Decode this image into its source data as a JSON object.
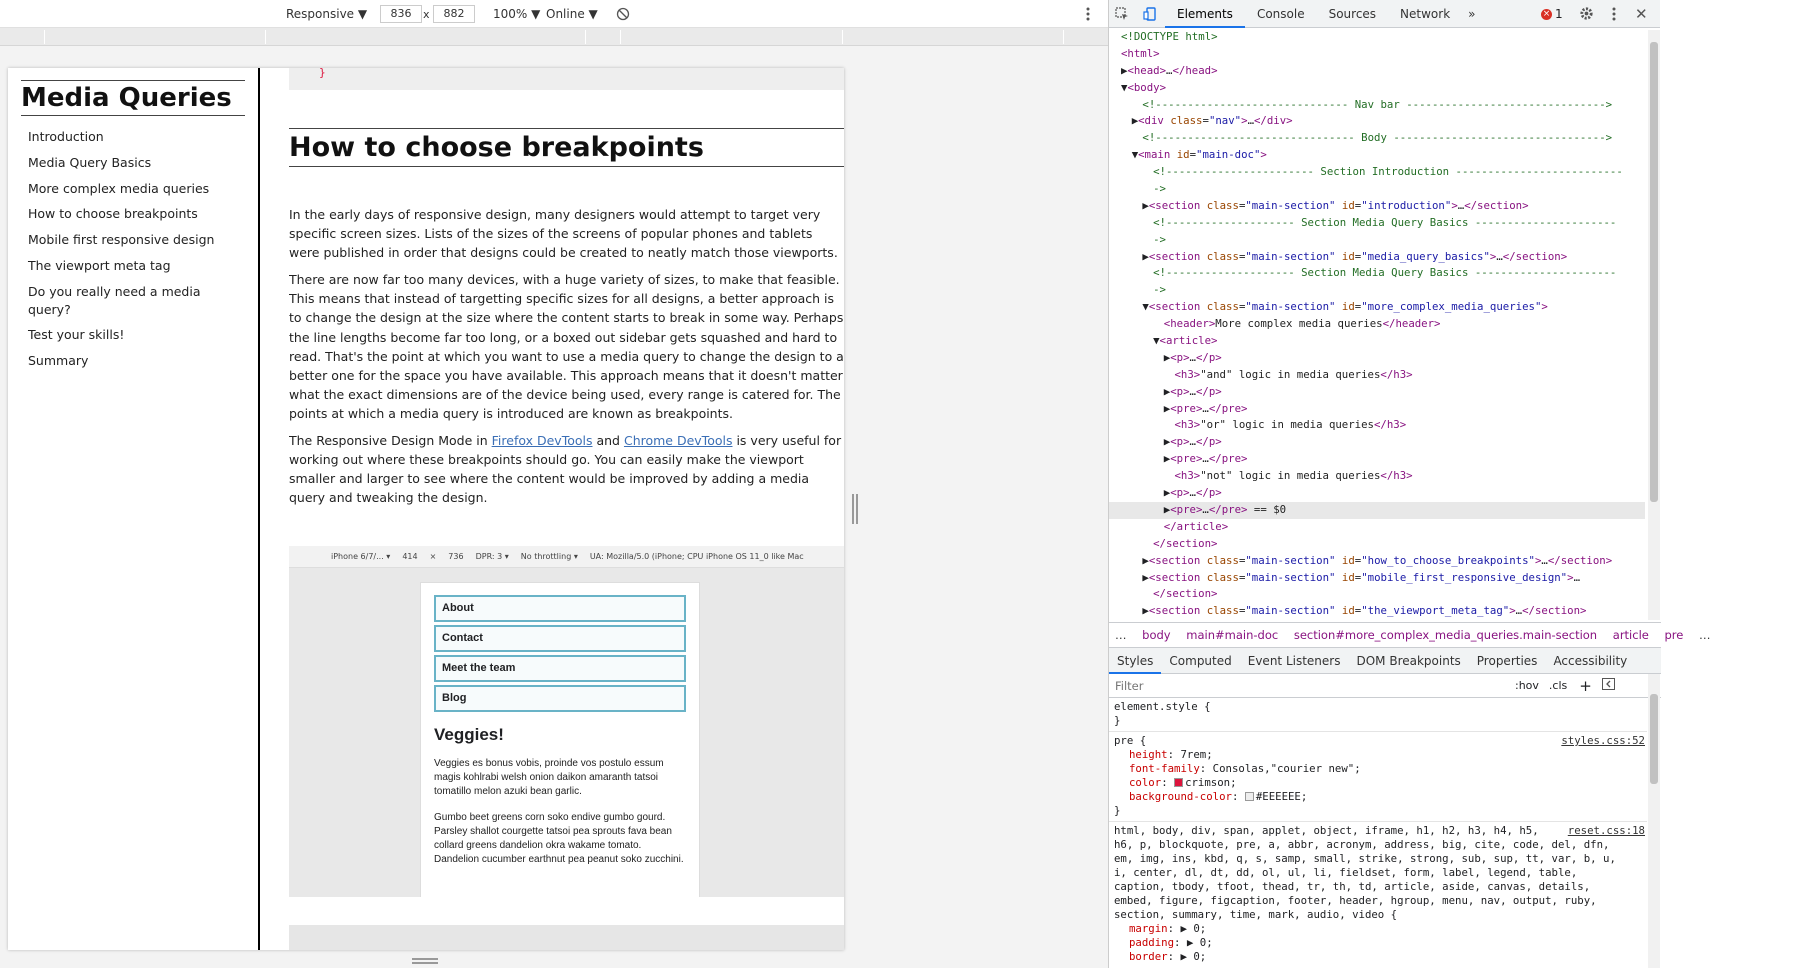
{
  "toolbar": {
    "device": "Responsive ▼",
    "width": "836",
    "times": "x",
    "height": "882",
    "zoom": "100% ▼",
    "network": "Online ▼"
  },
  "sidebar": {
    "title": "Media Queries",
    "items": [
      "Introduction",
      "Media Query Basics",
      "More complex media queries",
      "How to choose breakpoints",
      "Mobile first responsive design",
      "The viewport meta tag",
      "Do you really need a media query?",
      "Test your skills!",
      "Summary"
    ]
  },
  "main": {
    "pre_tail": "}",
    "heading": "How to choose breakpoints",
    "p1": "In the early days of responsive design, many designers would attempt to target very specific screen sizes. Lists of the sizes of the screens of popular phones and tablets were published in order that designs could be created to neatly match those viewports.",
    "p2": "There are now far too many devices, with a huge variety of sizes, to make that feasible. This means that instead of targetting specific sizes for all designs, a better approach is to change the design at the size where the content starts to break in some way. Perhaps the line lengths become far too long, or a boxed out sidebar gets squashed and hard to read. That's the point at which you want to use a media query to change the design to a better one for the space you have available. This approach means that it doesn't matter what the exact dimensions are of the device being used, every range is catered for. The points at which a media query is introduced are known as breakpoints.",
    "p3_a": "The Responsive Design Mode in ",
    "p3_link1": "Firefox DevTools",
    "p3_b": " and ",
    "p3_link2": "Chrome DevTools",
    "p3_c": " is very useful for working out where these breakpoints should go. You can easily make the viewport smaller and larger to see where the content would be improved by adding a media query and tweaking the design."
  },
  "screenshot": {
    "bar": [
      "iPhone 6/7/... ▾",
      "414",
      "×",
      "736",
      "DPR: 3 ▾",
      "No throttling ▾",
      "UA: Mozilla/5.0 (iPhone; CPU iPhone OS 11_0 like Mac"
    ],
    "nav": [
      "About",
      "Contact",
      "Meet the team",
      "Blog"
    ],
    "heading": "Veggies!",
    "p1": "Veggies es bonus vobis, proinde vos postulo essum magis kohlrabi welsh onion daikon amaranth tatsoi tomatillo melon azuki bean garlic.",
    "p2": "Gumbo beet greens corn soko endive gumbo gourd. Parsley shallot courgette tatsoi pea sprouts fava bean collard greens dandelion okra wakame tomato. Dandelion cucumber earthnut pea peanut soko zucchini."
  },
  "devtools": {
    "tabs": [
      "Elements",
      "Console",
      "Sources",
      "Network"
    ],
    "error_count": "1",
    "dom": [
      {
        "html": "<span class='cmt'>&lt;!DOCTYPE html&gt;</span>",
        "indent": 0
      },
      {
        "html": "<span class='tagc'>&lt;html&gt;</span>",
        "indent": 0
      },
      {
        "html": "▶<span class='tagc'>&lt;head&gt;</span>…<span class='tagc'>&lt;/head&gt;</span>",
        "indent": 0
      },
      {
        "html": "▼<span class='tagc'>&lt;body&gt;</span>",
        "indent": 0
      },
      {
        "html": "<span class='cmt'>&lt;!------------------------------ Nav bar -------------------------------&gt;</span>",
        "indent": 2
      },
      {
        "html": "▶<span class='tagc'>&lt;div </span><span class='attr'>class</span>=<span class='val'>\"nav\"</span><span class='tagc'>&gt;</span>…<span class='tagc'>&lt;/div&gt;</span>",
        "indent": 1
      },
      {
        "html": "<span class='cmt'>&lt;!------------------------------- Body ---------------------------------&gt;</span>",
        "indent": 2
      },
      {
        "html": "▼<span class='tagc'>&lt;main </span><span class='attr'>id</span>=<span class='val'>\"main-doc\"</span><span class='tagc'>&gt;</span>",
        "indent": 1
      },
      {
        "html": "<span class='cmt'>&lt;!----------------------- Section Introduction --------------------------</span>",
        "indent": 3
      },
      {
        "html": "<span class='cmt'>-&gt;</span>",
        "indent": 3
      },
      {
        "html": "▶<span class='tagc'>&lt;section </span><span class='attr'>class</span>=<span class='val'>\"main-section\"</span> <span class='attr'>id</span>=<span class='val'>\"introduction\"</span><span class='tagc'>&gt;</span>…<span class='tagc'>&lt;/section&gt;</span>",
        "indent": 2
      },
      {
        "html": "<span class='cmt'>&lt;!-------------------- Section Media Query Basics ----------------------</span>",
        "indent": 3
      },
      {
        "html": "<span class='cmt'>-&gt;</span>",
        "indent": 3
      },
      {
        "html": "▶<span class='tagc'>&lt;section </span><span class='attr'>class</span>=<span class='val'>\"main-section\"</span> <span class='attr'>id</span>=<span class='val'>\"media_query_basics\"</span><span class='tagc'>&gt;</span>…<span class='tagc'>&lt;/section&gt;</span>",
        "indent": 2
      },
      {
        "html": "<span class='cmt'>&lt;!-------------------- Section Media Query Basics ----------------------</span>",
        "indent": 3
      },
      {
        "html": "<span class='cmt'>-&gt;</span>",
        "indent": 3
      },
      {
        "html": "▼<span class='tagc'>&lt;section </span><span class='attr'>class</span>=<span class='val'>\"main-section\"</span> <span class='attr'>id</span>=<span class='val'>\"more_complex_media_queries\"</span><span class='tagc'>&gt;</span>",
        "indent": 2
      },
      {
        "html": "<span class='tagc'>&lt;header&gt;</span><span class='txt'>More complex media queries</span><span class='tagc'>&lt;/header&gt;</span>",
        "indent": 4
      },
      {
        "html": "▼<span class='tagc'>&lt;article&gt;</span>",
        "indent": 3
      },
      {
        "html": "▶<span class='tagc'>&lt;p&gt;</span>…<span class='tagc'>&lt;/p&gt;</span>",
        "indent": 4
      },
      {
        "html": "<span class='tagc'>&lt;h3&gt;</span><span class='txt'>\"and\" logic in media queries</span><span class='tagc'>&lt;/h3&gt;</span>",
        "indent": 5
      },
      {
        "html": "▶<span class='tagc'>&lt;p&gt;</span>…<span class='tagc'>&lt;/p&gt;</span>",
        "indent": 4
      },
      {
        "html": "▶<span class='tagc'>&lt;pre&gt;</span>…<span class='tagc'>&lt;/pre&gt;</span>",
        "indent": 4
      },
      {
        "html": "<span class='tagc'>&lt;h3&gt;</span><span class='txt'>\"or\" logic in media queries</span><span class='tagc'>&lt;/h3&gt;</span>",
        "indent": 5
      },
      {
        "html": "▶<span class='tagc'>&lt;p&gt;</span>…<span class='tagc'>&lt;/p&gt;</span>",
        "indent": 4
      },
      {
        "html": "▶<span class='tagc'>&lt;pre&gt;</span>…<span class='tagc'>&lt;/pre&gt;</span>",
        "indent": 4
      },
      {
        "html": "<span class='tagc'>&lt;h3&gt;</span><span class='txt'>\"not\" logic in media queries</span><span class='tagc'>&lt;/h3&gt;</span>",
        "indent": 5
      },
      {
        "html": "▶<span class='tagc'>&lt;p&gt;</span>…<span class='tagc'>&lt;/p&gt;</span>",
        "indent": 4
      },
      {
        "html": "▶<span class='tagc'>&lt;pre&gt;</span>…<span class='tagc'>&lt;/pre&gt;</span> <span class='txt'>== $0</span>",
        "indent": 4,
        "selected": true
      },
      {
        "html": "<span class='tagc'>&lt;/article&gt;</span>",
        "indent": 4
      },
      {
        "html": "<span class='tagc'>&lt;/section&gt;</span>",
        "indent": 3
      },
      {
        "html": "▶<span class='tagc'>&lt;section </span><span class='attr'>class</span>=<span class='val'>\"main-section\"</span> <span class='attr'>id</span>=<span class='val'>\"how_to_choose_breakpoints\"</span><span class='tagc'>&gt;</span>…<span class='tagc'>&lt;/section&gt;</span>",
        "indent": 2
      },
      {
        "html": "▶<span class='tagc'>&lt;section </span><span class='attr'>class</span>=<span class='val'>\"main-section\"</span> <span class='attr'>id</span>=<span class='val'>\"mobile_first_responsive_design\"</span><span class='tagc'>&gt;</span>…",
        "indent": 2
      },
      {
        "html": "<span class='tagc'>&lt;/section&gt;</span>",
        "indent": 3
      },
      {
        "html": "▶<span class='tagc'>&lt;section </span><span class='attr'>class</span>=<span class='val'>\"main-section\"</span> <span class='attr'>id</span>=<span class='val'>\"the_viewport_meta_tag\"</span><span class='tagc'>&gt;</span>…<span class='tagc'>&lt;/section&gt;</span>",
        "indent": 2
      }
    ],
    "breadcrumbs": [
      "…",
      "body",
      "main#main-doc",
      "section#more_complex_media_queries.main-section",
      "article",
      "pre",
      "…"
    ],
    "subtabs": [
      "Styles",
      "Computed",
      "Event Listeners",
      "DOM Breakpoints",
      "Properties",
      "Accessibility"
    ],
    "filter_placeholder": "Filter",
    "hov": ":hov",
    "cls": ".cls",
    "styles": {
      "element_style": "element.style {",
      "close": "}",
      "pre_selector": "pre {",
      "pre_source": "styles.css:52",
      "pre_props": [
        {
          "name": "height",
          "value": "7rem;"
        },
        {
          "name": "font-family",
          "value": "Consolas,\"courier new\";"
        },
        {
          "name": "color",
          "value": "crimson;",
          "swatch": "#dc143c"
        },
        {
          "name": "background-color",
          "value": "#EEEEEE;",
          "swatch": "#eeeeee"
        }
      ],
      "reset_source": "reset.css:18",
      "reset_lines": [
        "html, body, div, span, applet, object, iframe, h1, h2, h3, h4, h5,",
        "h6, p, blockquote, pre, a, abbr, acronym, address, big, cite, code, del, dfn,",
        "em, img, ins, kbd, q, s, samp, small, strike, strong, sub, sup, tt, var, b, u,",
        "i, center, dl, dt, dd, ol, ul, li, fieldset, form, label, legend, table,",
        "caption, tbody, tfoot, thead, tr, th, td, article, aside, canvas, details,",
        "embed, figure, figcaption, footer, header, hgroup, menu, nav, output, ruby,",
        "section, summary, time, mark, audio, video {"
      ],
      "reset_props": [
        {
          "name": "margin",
          "value": "▶ 0;"
        },
        {
          "name": "padding",
          "value": "▶ 0;"
        },
        {
          "name": "border",
          "value": "▶ 0;"
        }
      ]
    }
  }
}
